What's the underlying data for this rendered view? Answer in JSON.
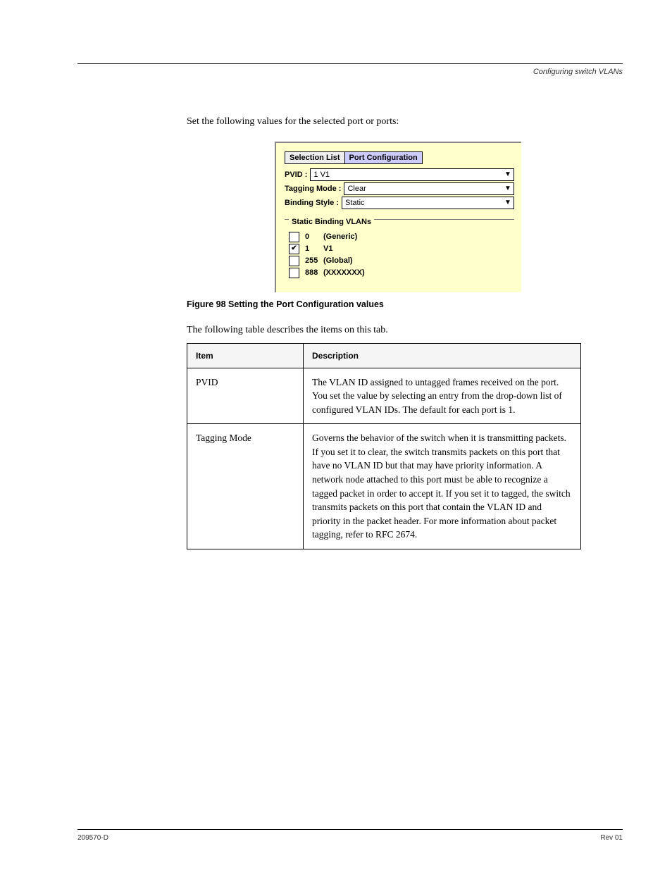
{
  "header": {
    "right": "Configuring switch VLANs"
  },
  "intro": "Set the following values for the selected port or ports:",
  "figure": {
    "tabs": [
      "Selection List",
      "Port Configuration"
    ],
    "active_tab": 1,
    "pvid_label": "PVID :",
    "pvid_value": "1     V1",
    "tag_label": "Tagging Mode :",
    "tag_value": "Clear",
    "bind_label": "Binding Style :",
    "bind_value": "Static",
    "group_title": "Static Binding VLANs",
    "vlans": [
      {
        "checked": false,
        "id": "0",
        "name": "(Generic)"
      },
      {
        "checked": true,
        "id": "1",
        "name": "V1"
      },
      {
        "checked": false,
        "id": "255",
        "name": "(Global)"
      },
      {
        "checked": false,
        "id": "888",
        "name": "(XXXXXXX)"
      }
    ],
    "caption": "Figure 98   Setting the Port Configuration values"
  },
  "table_intro": "The following table describes the items on this tab.",
  "table": {
    "headings": [
      "Item",
      "Description"
    ],
    "rows": [
      {
        "item": "PVID",
        "desc": "The VLAN ID assigned to untagged frames received on the port. You set the value by selecting an entry from the drop-down list of configured VLAN IDs. The default for each port is 1."
      },
      {
        "item": "Tagging Mode",
        "desc": "Governs the behavior of the switch when it is transmitting packets. If you set it to clear, the switch transmits packets on this port that have no VLAN ID but that may have priority information. A network node attached to this port must be able to recognize a tagged packet in order to accept it. If you set it to tagged, the switch transmits packets on this port that contain the VLAN ID and priority in the packet header. For more information about packet tagging, refer to RFC 2674."
      }
    ]
  },
  "footer": {
    "left": "209570-D",
    "right": "Rev 01"
  }
}
